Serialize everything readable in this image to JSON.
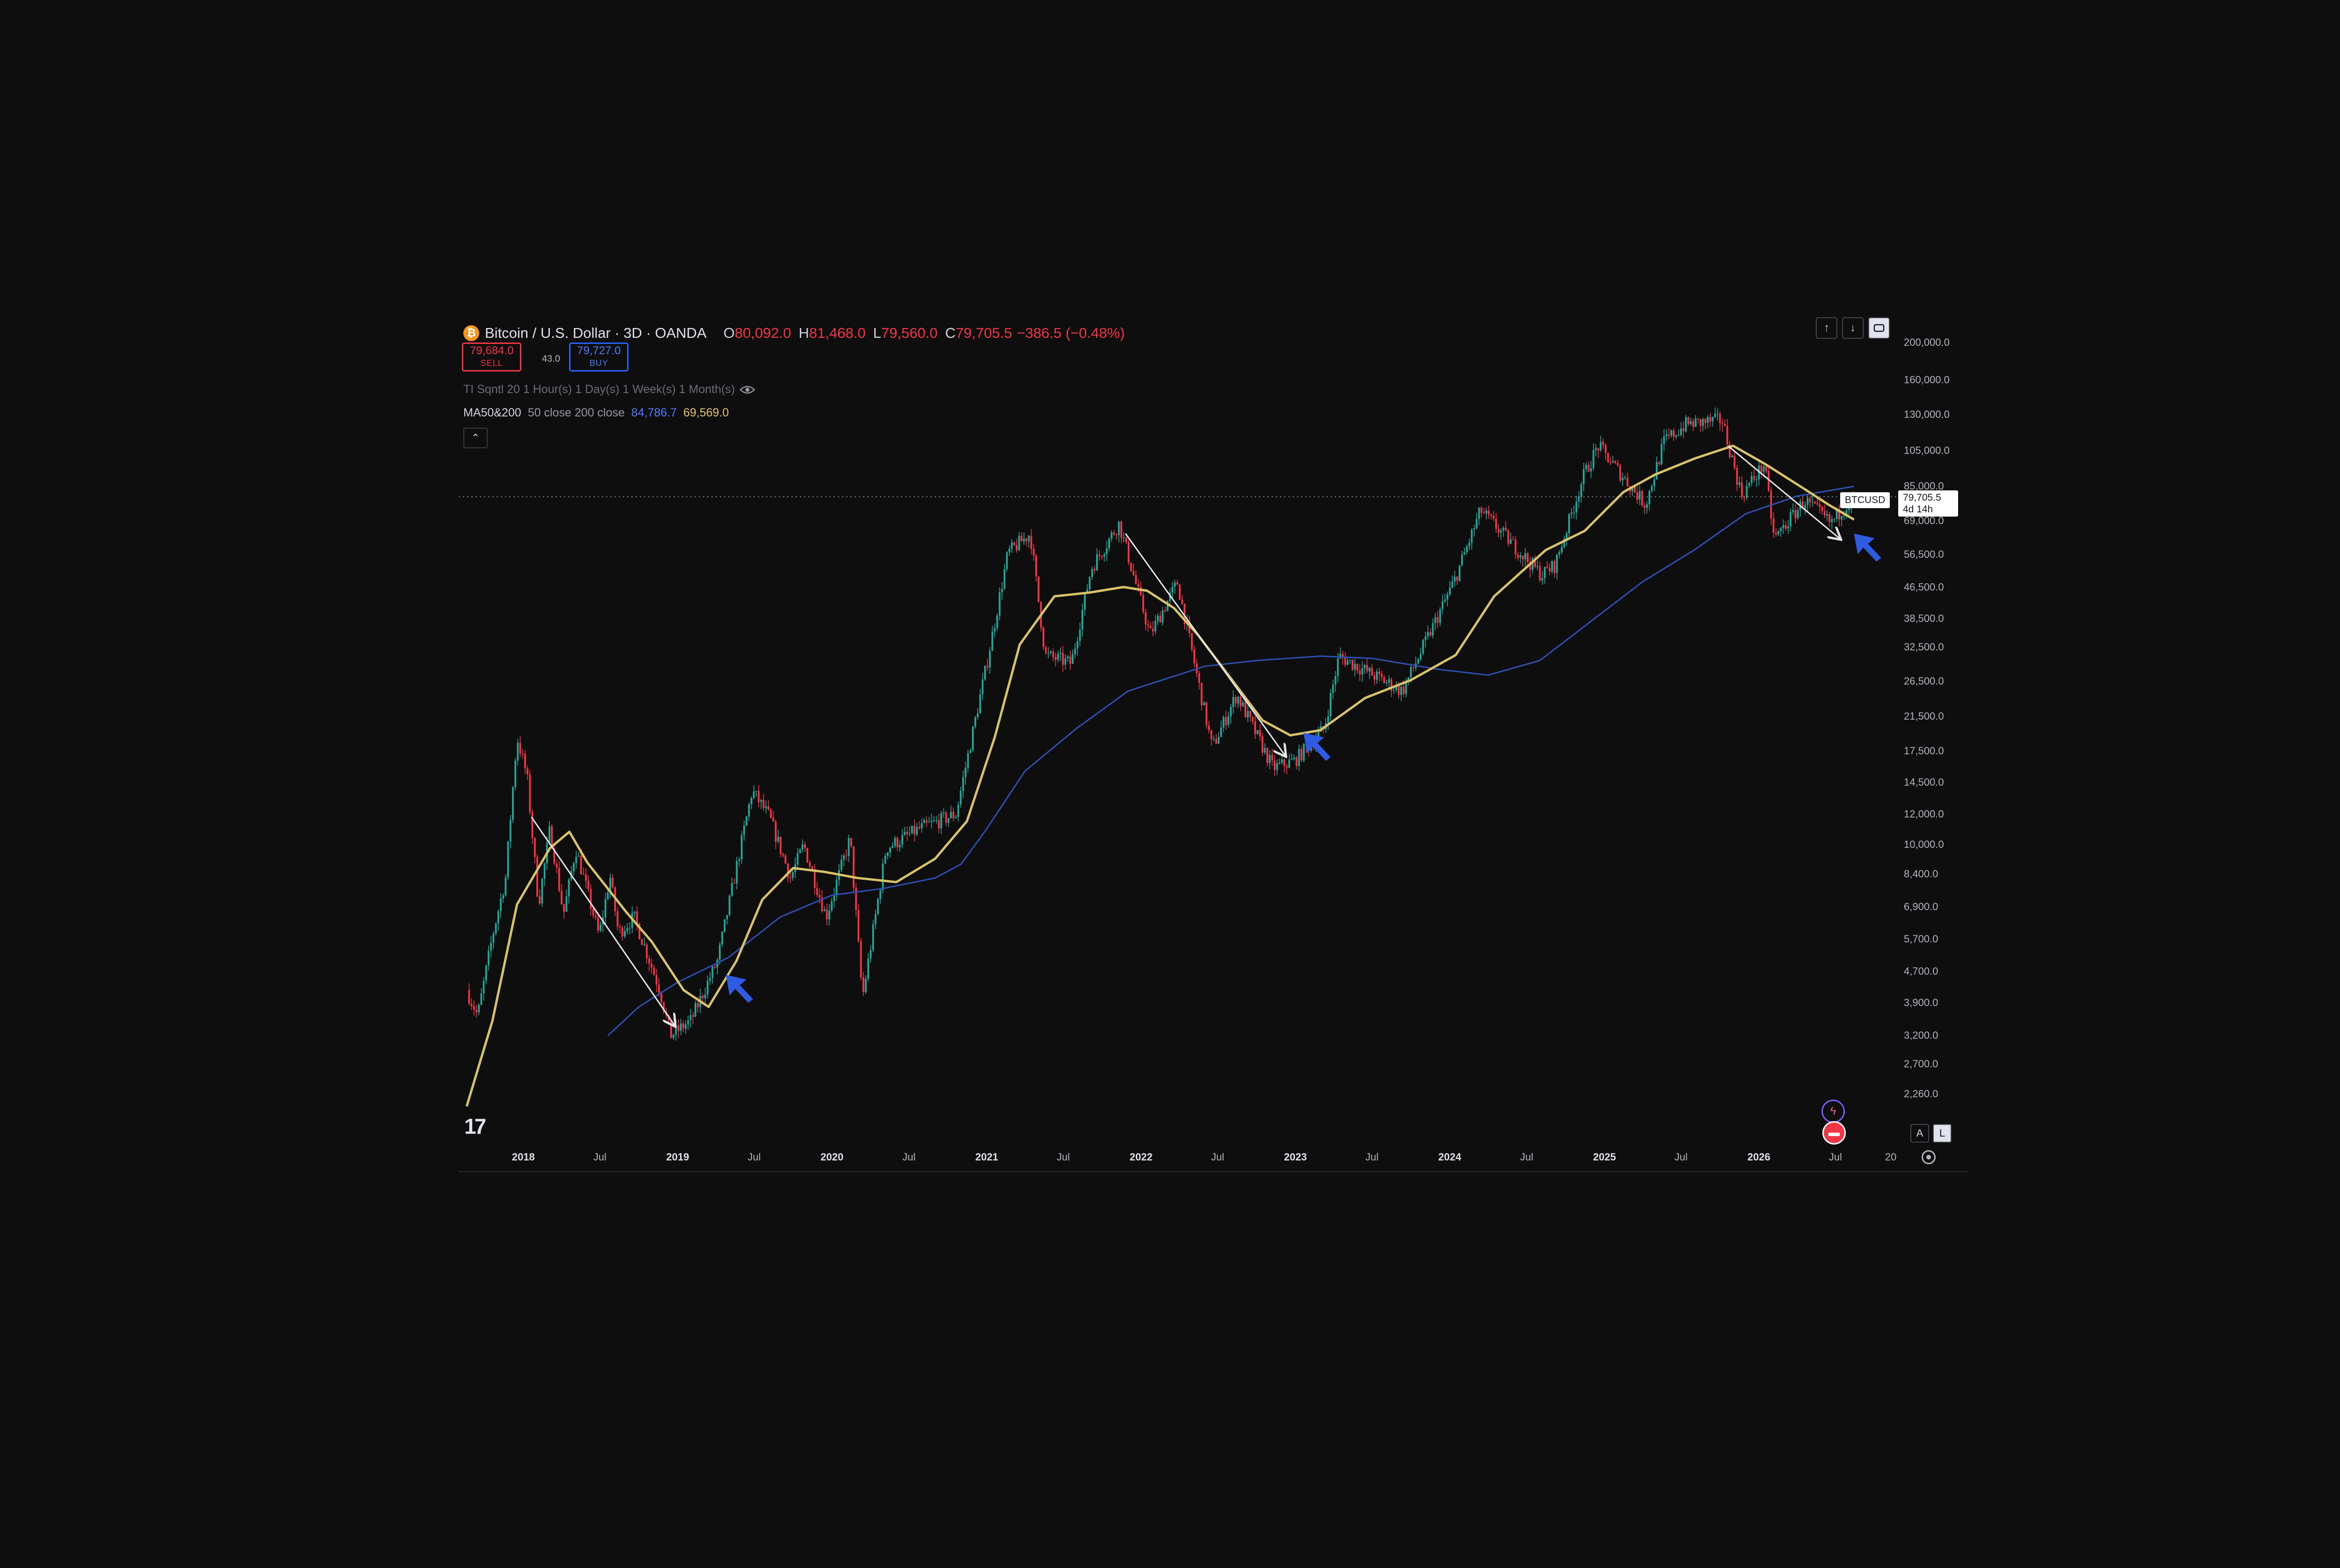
{
  "header": {
    "coin_glyph": "₿",
    "symbol_title": "Bitcoin / U.S. Dollar · 3D · OANDA",
    "open_key": "O",
    "open": "80,092.0",
    "high_key": "H",
    "high": "81,468.0",
    "low_key": "L",
    "low": "79,560.0",
    "close_key": "C",
    "close": "79,705.5",
    "change": "−386.5 (−0.48%)"
  },
  "trade": {
    "sell_price": "79,684.0",
    "sell_label": "SELL",
    "spread": "43.0",
    "buy_price": "79,727.0",
    "buy_label": "BUY"
  },
  "indicators": {
    "ti_label": "TI  Sqntl 20  1 Hour(s)  1 Day(s)  1 Week(s)  1 Month(s)",
    "ma_label": "MA50&200",
    "ma_params": "50 close 200 close",
    "ma200_value": "84,786.7",
    "ma50_value": "69,569.0"
  },
  "toolbar": {
    "up_icon": "↑",
    "down_icon": "↓",
    "collapse_icon": "⌃"
  },
  "price_tag": {
    "symbol": "BTCUSD",
    "price": "79,705.5",
    "countdown": "4d 14h"
  },
  "axis_buttons": {
    "auto": "A",
    "log": "L"
  },
  "colors": {
    "up": "#26a69a",
    "down": "#f23645",
    "ma50": "#d9c36a",
    "ma200": "#2e4fb3",
    "arrow_blue": "#2f5be0",
    "annotation": "#e6e6e6"
  },
  "chart_data": {
    "type": "candlestick",
    "title": "Bitcoin / U.S. Dollar · 3D · OANDA",
    "y_scale": "log",
    "y_ticks": [
      "200,000.0",
      "160,000.0",
      "130,000.0",
      "105,000.0",
      "85,000.0",
      "69,000.0",
      "56,500.0",
      "46,500.0",
      "38,500.0",
      "32,500.0",
      "26,500.0",
      "21,500.0",
      "17,500.0",
      "14,500.0",
      "12,000.0",
      "10,000.0",
      "8,400.0",
      "6,900.0",
      "5,700.0",
      "4,700.0",
      "3,900.0",
      "3,200.0",
      "2,700.0",
      "2,260.0"
    ],
    "x_ticks": [
      {
        "label": "2018",
        "major": true
      },
      {
        "label": "Jul",
        "major": false
      },
      {
        "label": "2019",
        "major": true
      },
      {
        "label": "Jul",
        "major": false
      },
      {
        "label": "2020",
        "major": true
      },
      {
        "label": "Jul",
        "major": false
      },
      {
        "label": "2021",
        "major": true
      },
      {
        "label": "Jul",
        "major": false
      },
      {
        "label": "2022",
        "major": true
      },
      {
        "label": "Jul",
        "major": false
      },
      {
        "label": "2023",
        "major": true
      },
      {
        "label": "Jul",
        "major": false
      },
      {
        "label": "2024",
        "major": true
      },
      {
        "label": "Jul",
        "major": false
      },
      {
        "label": "2025",
        "major": true
      },
      {
        "label": "Jul",
        "major": false
      },
      {
        "label": "2026",
        "major": true
      },
      {
        "label": "Jul",
        "major": false
      },
      {
        "label": "20",
        "major": false
      }
    ],
    "price_path": [
      [
        "2017-08-20",
        4200
      ],
      [
        "2017-09-15",
        3600
      ],
      [
        "2017-10-20",
        5800
      ],
      [
        "2017-11-20",
        8200
      ],
      [
        "2017-12-17",
        19000
      ],
      [
        "2018-01-10",
        15000
      ],
      [
        "2018-02-06",
        7000
      ],
      [
        "2018-03-05",
        11000
      ],
      [
        "2018-04-06",
        6600
      ],
      [
        "2018-05-05",
        9800
      ],
      [
        "2018-06-29",
        5800
      ],
      [
        "2018-07-25",
        8300
      ],
      [
        "2018-08-14",
        5900
      ],
      [
        "2018-09-20",
        6500
      ],
      [
        "2018-11-20",
        4200
      ],
      [
        "2018-12-15",
        3200
      ],
      [
        "2019-02-01",
        3500
      ],
      [
        "2019-04-05",
        5000
      ],
      [
        "2019-06-26",
        13800
      ],
      [
        "2019-08-06",
        11800
      ],
      [
        "2019-09-25",
        8200
      ],
      [
        "2019-10-26",
        10000
      ],
      [
        "2019-12-18",
        6500
      ],
      [
        "2020-02-13",
        10400
      ],
      [
        "2020-03-13",
        4000
      ],
      [
        "2020-05-08",
        9800
      ],
      [
        "2020-07-26",
        11000
      ],
      [
        "2020-10-20",
        12000
      ],
      [
        "2020-12-31",
        29000
      ],
      [
        "2021-02-20",
        57000
      ],
      [
        "2021-04-14",
        64000
      ],
      [
        "2021-05-19",
        31000
      ],
      [
        "2021-07-20",
        29500
      ],
      [
        "2021-09-05",
        52000
      ],
      [
        "2021-11-10",
        68000
      ],
      [
        "2022-01-22",
        35000
      ],
      [
        "2022-03-28",
        47800
      ],
      [
        "2022-06-18",
        17800
      ],
      [
        "2022-08-15",
        24500
      ],
      [
        "2022-11-09",
        15800
      ],
      [
        "2022-12-30",
        16500
      ],
      [
        "2023-03-10",
        20000
      ],
      [
        "2023-04-14",
        30800
      ],
      [
        "2023-09-11",
        25000
      ],
      [
        "2024-01-11",
        48000
      ],
      [
        "2024-03-14",
        73500
      ],
      [
        "2024-08-05",
        50000
      ],
      [
        "2024-09-06",
        53000
      ],
      [
        "2024-11-12",
        90000
      ],
      [
        "2024-12-17",
        108000
      ],
      [
        "2025-04-08",
        76000
      ],
      [
        "2025-05-22",
        111000
      ],
      [
        "2025-07-14",
        123000
      ],
      [
        "2025-08-14",
        124000
      ],
      [
        "2025-10-06",
        126000
      ],
      [
        "2025-11-21",
        80500
      ],
      [
        "2026-01-14",
        97000
      ],
      [
        "2026-02-06",
        62000
      ],
      [
        "2026-04-20",
        78000
      ],
      [
        "2026-06-20",
        68000
      ],
      [
        "2026-08-12",
        80092
      ],
      [
        "2026-08-14",
        79705.5
      ]
    ],
    "ma50": [
      [
        "2017-08-20",
        2100
      ],
      [
        "2017-10-20",
        3500
      ],
      [
        "2017-12-17",
        7000
      ],
      [
        "2018-03-05",
        9800
      ],
      [
        "2018-04-20",
        10800
      ],
      [
        "2018-06-01",
        9000
      ],
      [
        "2018-09-01",
        6700
      ],
      [
        "2018-11-01",
        5600
      ],
      [
        "2019-01-15",
        4200
      ],
      [
        "2019-03-15",
        3800
      ],
      [
        "2019-05-20",
        5000
      ],
      [
        "2019-07-20",
        7200
      ],
      [
        "2019-10-01",
        8700
      ],
      [
        "2019-12-15",
        8500
      ],
      [
        "2020-03-01",
        8200
      ],
      [
        "2020-06-01",
        8000
      ],
      [
        "2020-09-01",
        9200
      ],
      [
        "2020-11-15",
        11500
      ],
      [
        "2021-01-20",
        19000
      ],
      [
        "2021-03-20",
        33000
      ],
      [
        "2021-06-10",
        44000
      ],
      [
        "2021-09-01",
        45000
      ],
      [
        "2021-11-20",
        46500
      ],
      [
        "2022-01-15",
        45500
      ],
      [
        "2022-03-20",
        41000
      ],
      [
        "2022-05-15",
        35000
      ],
      [
        "2022-08-01",
        27000
      ],
      [
        "2022-10-15",
        21000
      ],
      [
        "2022-12-20",
        19200
      ],
      [
        "2023-03-01",
        19800
      ],
      [
        "2023-06-15",
        24000
      ],
      [
        "2023-10-01",
        26700
      ],
      [
        "2024-01-15",
        31000
      ],
      [
        "2024-04-15",
        44000
      ],
      [
        "2024-08-15",
        58000
      ],
      [
        "2024-11-15",
        65000
      ],
      [
        "2025-02-15",
        82000
      ],
      [
        "2025-05-01",
        91000
      ],
      [
        "2025-08-01",
        100000
      ],
      [
        "2025-11-01",
        108000
      ],
      [
        "2026-01-15",
        97000
      ],
      [
        "2026-04-15",
        84000
      ],
      [
        "2026-06-15",
        76000
      ],
      [
        "2026-08-14",
        69569
      ]
    ],
    "ma200": [
      [
        "2018-07-20",
        3200
      ],
      [
        "2018-10-01",
        3800
      ],
      [
        "2019-01-01",
        4400
      ],
      [
        "2019-05-01",
        5100
      ],
      [
        "2019-09-01",
        6500
      ],
      [
        "2020-01-01",
        7400
      ],
      [
        "2020-05-01",
        7700
      ],
      [
        "2020-09-01",
        8200
      ],
      [
        "2020-11-01",
        8900
      ],
      [
        "2021-01-01",
        11000
      ],
      [
        "2021-04-01",
        15500
      ],
      [
        "2021-08-01",
        20000
      ],
      [
        "2021-12-01",
        25000
      ],
      [
        "2022-06-01",
        29000
      ],
      [
        "2022-10-01",
        30000
      ],
      [
        "2023-03-01",
        30800
      ],
      [
        "2023-07-01",
        30400
      ],
      [
        "2023-12-01",
        28500
      ],
      [
        "2024-04-01",
        27500
      ],
      [
        "2024-08-01",
        30000
      ],
      [
        "2024-12-01",
        38000
      ],
      [
        "2025-04-01",
        48000
      ],
      [
        "2025-08-01",
        58000
      ],
      [
        "2025-12-01",
        72000
      ],
      [
        "2026-04-01",
        80000
      ],
      [
        "2026-08-14",
        84786.7
      ]
    ],
    "annotations": [
      {
        "type": "trend_arrow",
        "from": [
          "2018-01-20",
          11800
        ],
        "to": [
          "2018-12-25",
          3400
        ]
      },
      {
        "type": "trend_arrow",
        "from": [
          "2021-11-25",
          64000
        ],
        "to": [
          "2022-12-08",
          17000
        ]
      },
      {
        "type": "trend_arrow",
        "from": [
          "2025-10-20",
          108000
        ],
        "to": [
          "2026-07-12",
          62000
        ]
      },
      {
        "type": "highlight_arrow",
        "at": [
          "2019-04-25",
          4600
        ]
      },
      {
        "type": "highlight_arrow",
        "at": [
          "2023-01-20",
          19500
        ]
      },
      {
        "type": "highlight_arrow",
        "at": [
          "2026-08-14",
          64000
        ]
      }
    ]
  }
}
